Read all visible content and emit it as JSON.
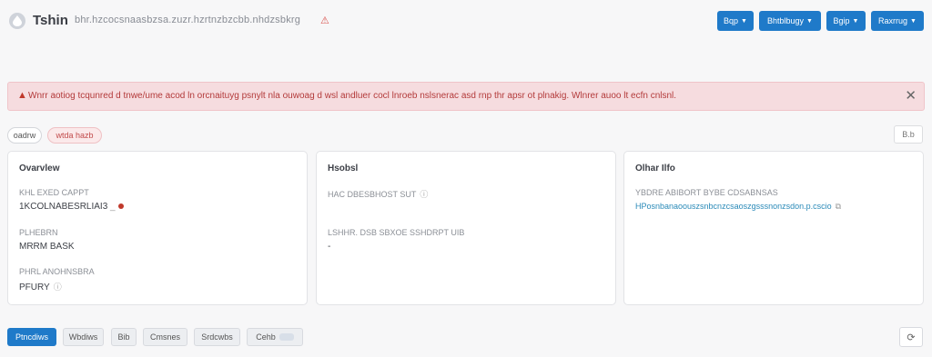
{
  "header": {
    "title": "Tshin",
    "subtitle": "bhr.hzcocsnaasbzsa.zuzr.hzrtnzbzcbb.nhdzsbkrg",
    "warning_icon": "warning-triangle-icon",
    "buttons": [
      {
        "label": "Bqp"
      },
      {
        "label": "Bhtblbugy"
      },
      {
        "label": "Bgip"
      },
      {
        "label": "Raxrrug"
      }
    ]
  },
  "alert": {
    "text": "Wnrr aotiog tcqunred d tnwe/ume acod ln orcnaituyg psnylt nla ouwoag d wsl andluer cocl lnroeb nslsnerac asd rnp thr apsr ot plnakig. Wlnrer auoo lt ecfn cnlsnl.",
    "close_icon": "close-icon"
  },
  "pills": {
    "left": "oadrw",
    "right": "wtda hazb",
    "menu": "B.b"
  },
  "cards": {
    "overview": {
      "title": "Ovarvlew",
      "fields": [
        {
          "label": "KHL EXED CAPPT",
          "value": "1KCOLNABESRLIAI3"
        },
        {
          "label": "PLHEBRN",
          "value": "MRRM BASK"
        },
        {
          "label": "PHRL ANOHNSBRA",
          "value": "PFURY"
        }
      ]
    },
    "hosted": {
      "title": "Hsobsl",
      "fields": [
        {
          "label": "HAC DBESBHOST SUT",
          "value": ""
        },
        {
          "label": "LSHHR. DSB SBXOE SSHDRPT UIB",
          "value": "-"
        }
      ]
    },
    "other": {
      "title": "Olhar Ilfo",
      "fields": [
        {
          "label": "YBDRE ABIBORT BYBE CDSABNSAS",
          "value": "HPosnbanaoouszsnbcnzcsaoszgsssnonzsdon.p.cscio"
        }
      ]
    }
  },
  "tabs": [
    {
      "label": "Ptncdiws",
      "active": true
    },
    {
      "label": "Wbdiws",
      "active": false
    },
    {
      "label": "Bib",
      "active": false
    },
    {
      "label": "Cmsnes",
      "active": false
    },
    {
      "label": "Srdcwbs",
      "active": false
    },
    {
      "label": "Cehb",
      "active": false
    }
  ],
  "colors": {
    "primary": "#1f7ac9",
    "alert_bg": "#f6dcdf",
    "alert_text": "#b33a3a"
  }
}
